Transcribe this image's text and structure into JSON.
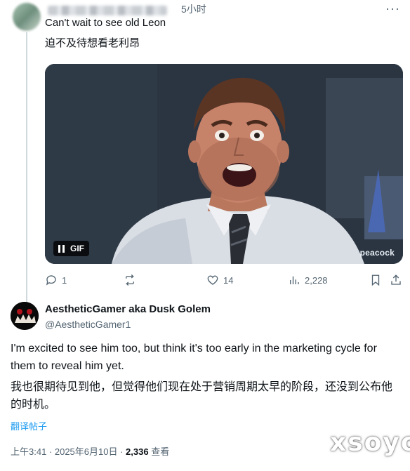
{
  "reply": {
    "time": "5小时",
    "text_en": "Can't wait to see old Leon",
    "text_cn": "迫不及待想看老利昂",
    "gif": {
      "badge_label": "GIF",
      "brand": "peacock"
    },
    "actions": {
      "replies": "1",
      "reposts": "",
      "likes": "14",
      "views": "2,228"
    }
  },
  "main_tweet": {
    "display_name": "AestheticGamer aka Dusk Golem",
    "handle": "@AestheticGamer1",
    "text_en": "I'm excited to see him too, but think it's too early in the marketing cycle for them to reveal him yet.",
    "text_cn": "我也很期待见到他，但觉得他们现在处于营销周期太早的阶段，还没到公布他的时机。",
    "translate_label": "翻译帖子",
    "time": "上午3:41 · 2025年6月10日 · ",
    "views_count": "2,336",
    "views_label": " 查看"
  },
  "watermark": "xsoyo",
  "icons": [
    "more-icon",
    "reply-icon",
    "repost-icon",
    "like-icon",
    "views-icon",
    "bookmark-icon",
    "share-icon",
    "pause-icon"
  ],
  "colors": {
    "accent": "#1d9bf0",
    "muted": "#536471",
    "text": "#0f1419"
  }
}
